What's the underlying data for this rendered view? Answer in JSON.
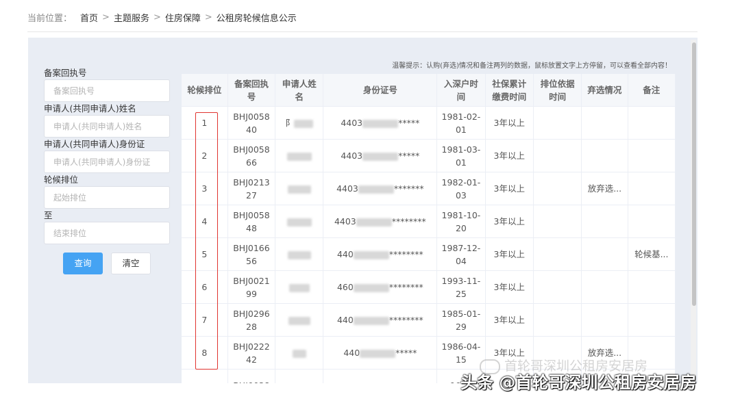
{
  "breadcrumb": {
    "prefix": "当前位置：",
    "items": [
      "首页",
      "主题服务",
      "住房保障",
      "公租房轮候信息公示"
    ],
    "separator": ">"
  },
  "filter": {
    "fields": [
      {
        "label": "备案回执号",
        "placeholder": "备案回执号"
      },
      {
        "label": "申请人(共同申请人)姓名",
        "placeholder": "申请人(共同申请人)姓名"
      },
      {
        "label": "申请人(共同申请人)身份证",
        "placeholder": "申请人(共同申请人)身份证"
      },
      {
        "label": "轮候排位",
        "placeholder": "起始排位"
      },
      {
        "label": "至",
        "placeholder": "结束排位"
      }
    ],
    "query_label": "查询",
    "clear_label": "清空"
  },
  "tip": "温馨提示：认购(弃选)情况和备注两列的数据，鼠标放置文字上方停留，可以查看全部内容！",
  "table": {
    "headers": [
      "轮候排位",
      "备案回执号",
      "申请人姓名",
      "身份证号",
      "入深户时间",
      "社保累计缴费时间",
      "排位依据时间",
      "弃选情况",
      "备注"
    ],
    "rows": [
      {
        "rank": "1",
        "receipt": "BHJ005840",
        "name": "阝",
        "id_prefix": "4403",
        "id_suffix": "*****",
        "hukou": "1981-02-01",
        "social": "3年以上",
        "basis": "",
        "abandon": "",
        "note": ""
      },
      {
        "rank": "2",
        "receipt": "BHJ005866",
        "name": "",
        "id_prefix": "4403",
        "id_suffix": "*****",
        "hukou": "1981-03-01",
        "social": "3年以上",
        "basis": "",
        "abandon": "",
        "note": ""
      },
      {
        "rank": "3",
        "receipt": "BHJ021327",
        "name": "",
        "id_prefix": "4403",
        "id_suffix": "*******",
        "hukou": "1982-01-03",
        "social": "3年以上",
        "basis": "",
        "abandon": "放弃选...",
        "note": ""
      },
      {
        "rank": "4",
        "receipt": "BHJ005848",
        "name": "",
        "id_prefix": "4403",
        "id_suffix": "********",
        "hukou": "1981-10-20",
        "social": "3年以上",
        "basis": "",
        "abandon": "",
        "note": ""
      },
      {
        "rank": "5",
        "receipt": "BHJ016656",
        "name": "",
        "id_prefix": "440",
        "id_suffix": "********",
        "hukou": "1987-12-04",
        "social": "3年以上",
        "basis": "",
        "abandon": "",
        "note": "轮候基..."
      },
      {
        "rank": "6",
        "receipt": "BHJ002199",
        "name": "",
        "id_prefix": "460",
        "id_suffix": "********",
        "hukou": "1993-11-25",
        "social": "3年以上",
        "basis": "",
        "abandon": "",
        "note": ""
      },
      {
        "rank": "7",
        "receipt": "BHJ029628",
        "name": "",
        "id_prefix": "440",
        "id_suffix": "********",
        "hukou": "1985-01-29",
        "social": "3年以上",
        "basis": "",
        "abandon": "",
        "note": ""
      },
      {
        "rank": "8",
        "receipt": "BHJ022242",
        "name": "",
        "id_prefix": "440",
        "id_suffix": "*****",
        "hukou": "1986-04-15",
        "social": "3年以上",
        "basis": "",
        "abandon": "放弃选...",
        "note": ""
      },
      {
        "rank": "",
        "receipt": "BHJ0038",
        "name": "",
        "id_prefix": "",
        "id_suffix": "",
        "hukou": "1986",
        "social": "",
        "basis": "",
        "abandon": "",
        "note": ""
      }
    ]
  },
  "watermark": {
    "faint": "首轮哥深圳公租房安居房",
    "main": "头条 @首轮哥深圳公租房安居房"
  },
  "colors": {
    "primary": "#45a3f3",
    "highlight_border": "#e0332e",
    "panel_bg": "#e9edf4"
  }
}
